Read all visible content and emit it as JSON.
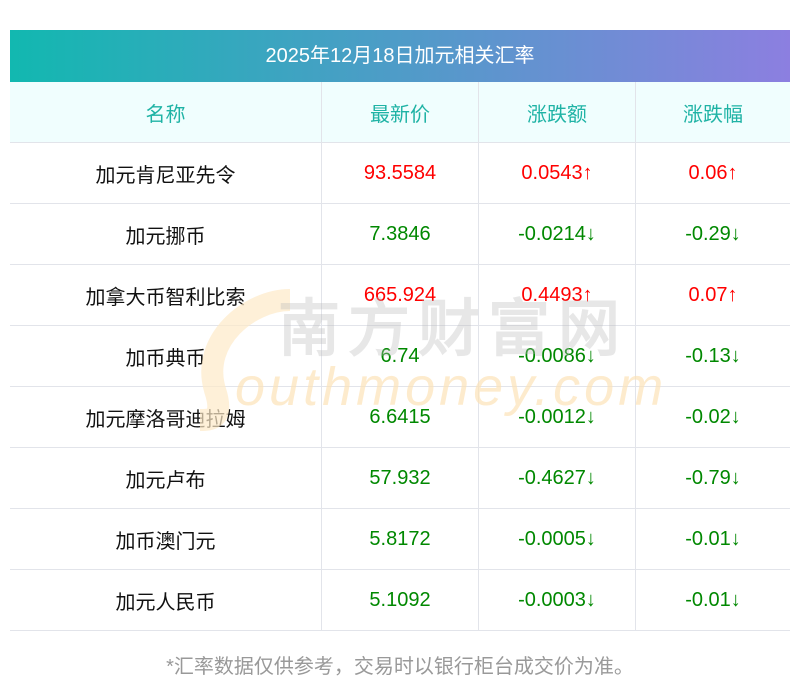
{
  "title": "2025年12月18日加元相关汇率",
  "columns": [
    "名称",
    "最新价",
    "涨跌额",
    "涨跌幅"
  ],
  "rows": [
    {
      "name": "加元肯尼亚先令",
      "price": "93.5584",
      "change": "0.0543↑",
      "pct": "0.06↑",
      "dir": "up"
    },
    {
      "name": "加元挪币",
      "price": "7.3846",
      "change": "-0.0214↓",
      "pct": "-0.29↓",
      "dir": "down"
    },
    {
      "name": "加拿大币智利比索",
      "price": "665.924",
      "change": "0.4493↑",
      "pct": "0.07↑",
      "dir": "up"
    },
    {
      "name": "加币典币",
      "price": "6.74",
      "change": "-0.0086↓",
      "pct": "-0.13↓",
      "dir": "down"
    },
    {
      "name": "加元摩洛哥迪拉姆",
      "price": "6.6415",
      "change": "-0.0012↓",
      "pct": "-0.02↓",
      "dir": "down"
    },
    {
      "name": "加元卢布",
      "price": "57.932",
      "change": "-0.4627↓",
      "pct": "-0.79↓",
      "dir": "down"
    },
    {
      "name": "加币澳门元",
      "price": "5.8172",
      "change": "-0.0005↓",
      "pct": "-0.01↓",
      "dir": "down"
    },
    {
      "name": "加元人民币",
      "price": "5.1092",
      "change": "-0.0003↓",
      "pct": "-0.01↓",
      "dir": "down"
    }
  ],
  "footer": "*汇率数据仅供参考，交易时以银行柜台成交价为准。",
  "watermark": {
    "cn": "南方财富网",
    "en": "Southmoney.com"
  },
  "colors": {
    "up": "#ff0000",
    "down": "#008800",
    "header_text": "#1fb3a5"
  }
}
